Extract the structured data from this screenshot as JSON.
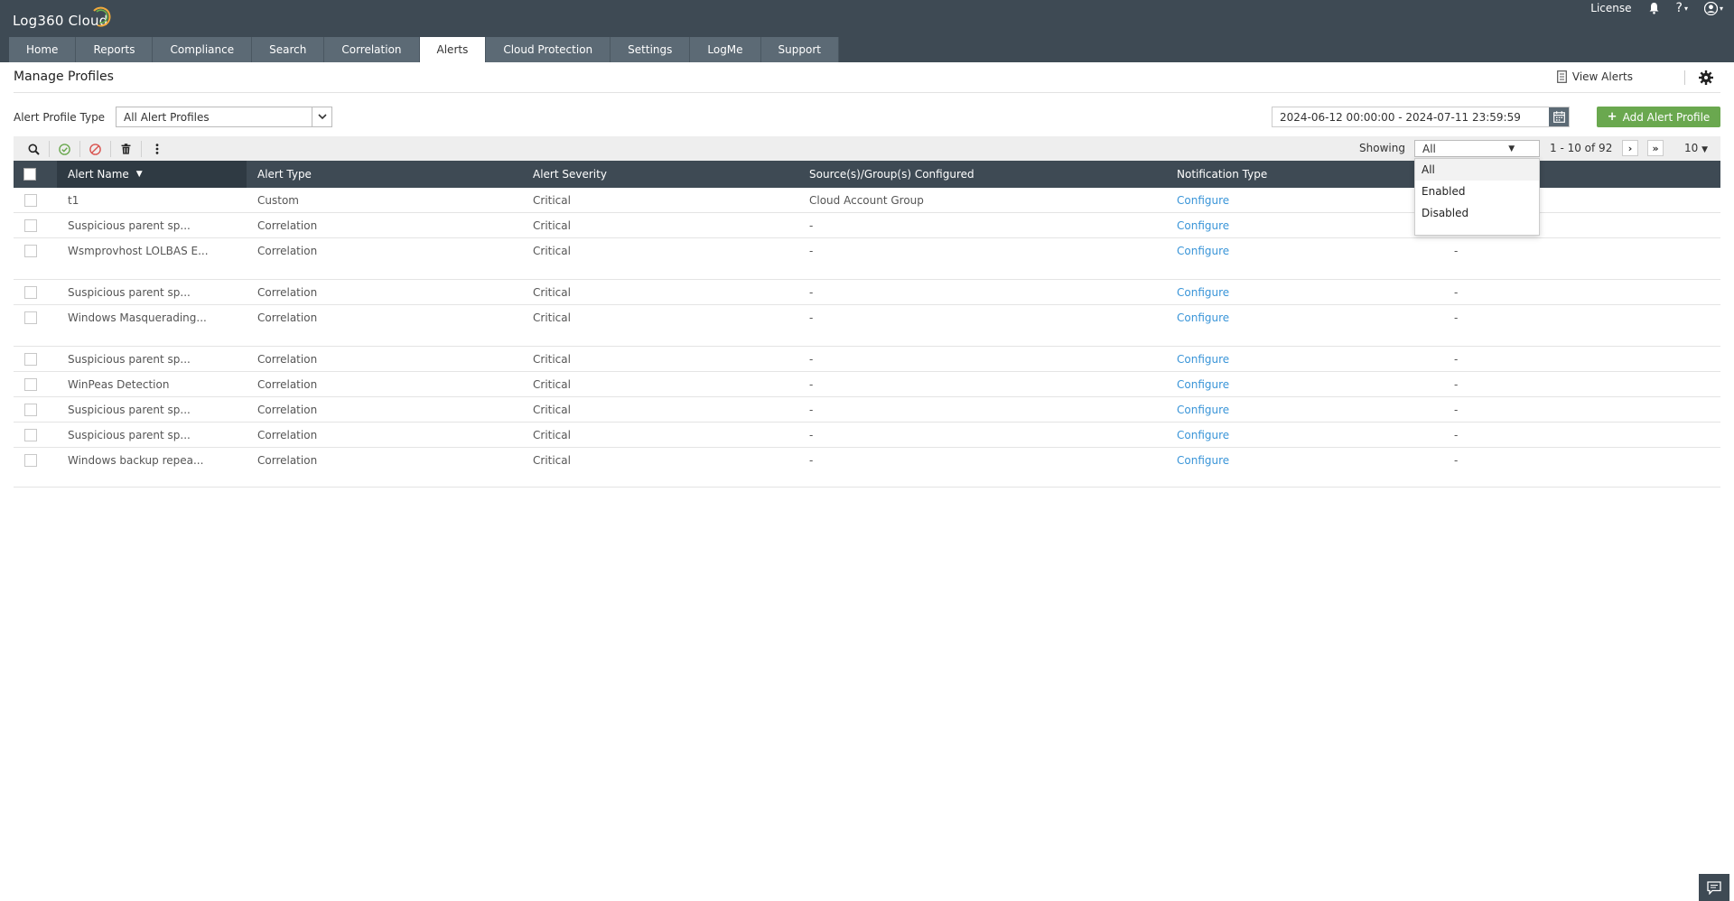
{
  "app": {
    "title": "Log360 Cloud"
  },
  "topbar": {
    "license": "License",
    "help": "?"
  },
  "tabs": [
    "Home",
    "Reports",
    "Compliance",
    "Search",
    "Correlation",
    "Alerts",
    "Cloud Protection",
    "Settings",
    "LogMe",
    "Support"
  ],
  "active_tab": "Alerts",
  "page": {
    "title": "Manage Profiles",
    "view_alerts": "View Alerts"
  },
  "filters": {
    "alert_profile_type_label": "Alert Profile Type",
    "alert_profile_type_value": "All Alert Profiles",
    "date_range": "2024-06-12 00:00:00 - 2024-07-11 23:59:59",
    "add_button": "Add Alert Profile"
  },
  "toolbar": {
    "showing_label": "Showing",
    "showing_value": "All",
    "pagination": "1 - 10 of 92",
    "per_page": "10"
  },
  "showing_options": [
    "All",
    "Enabled",
    "Disabled"
  ],
  "table": {
    "columns": [
      "Alert Name",
      "Alert Type",
      "Alert Severity",
      "Source(s)/Group(s) Configured",
      "Notification Type"
    ],
    "rows": [
      {
        "name": "t1",
        "type": "Custom",
        "severity": "Critical",
        "source": "Cloud Account Group",
        "notification": "Configure",
        "extra": ""
      },
      {
        "name": "Suspicious parent sp...",
        "type": "Correlation",
        "severity": "Critical",
        "source": "-",
        "notification": "Configure",
        "extra": ""
      },
      {
        "name": "Wsmprovhost LOLBAS E...",
        "type": "Correlation",
        "severity": "Critical",
        "source": "-",
        "notification": "Configure",
        "extra": "-"
      },
      {
        "name": "Suspicious parent sp...",
        "type": "Correlation",
        "severity": "Critical",
        "source": "-",
        "notification": "Configure",
        "extra": "-"
      },
      {
        "name": "Windows Masquerading...",
        "type": "Correlation",
        "severity": "Critical",
        "source": "-",
        "notification": "Configure",
        "extra": "-"
      },
      {
        "name": "Suspicious parent sp...",
        "type": "Correlation",
        "severity": "Critical",
        "source": "-",
        "notification": "Configure",
        "extra": "-"
      },
      {
        "name": "WinPeas Detection",
        "type": "Correlation",
        "severity": "Critical",
        "source": "-",
        "notification": "Configure",
        "extra": "-"
      },
      {
        "name": "Suspicious parent sp...",
        "type": "Correlation",
        "severity": "Critical",
        "source": "-",
        "notification": "Configure",
        "extra": "-"
      },
      {
        "name": "Suspicious parent sp...",
        "type": "Correlation",
        "severity": "Critical",
        "source": "-",
        "notification": "Configure",
        "extra": "-"
      },
      {
        "name": "Windows backup repea...",
        "type": "Correlation",
        "severity": "Critical",
        "source": "-",
        "notification": "Configure",
        "extra": "-"
      }
    ]
  },
  "colors": {
    "header_bg": "#3e4a54",
    "tab_bg": "#5c6a75",
    "accent_green": "#6aa84f",
    "link": "#3a95d8"
  },
  "icons": [
    "bell-icon",
    "help-icon",
    "user-icon",
    "gear-icon",
    "calendar-icon",
    "search-icon",
    "enable-icon",
    "disable-icon",
    "delete-icon",
    "more-icon",
    "chat-icon"
  ]
}
